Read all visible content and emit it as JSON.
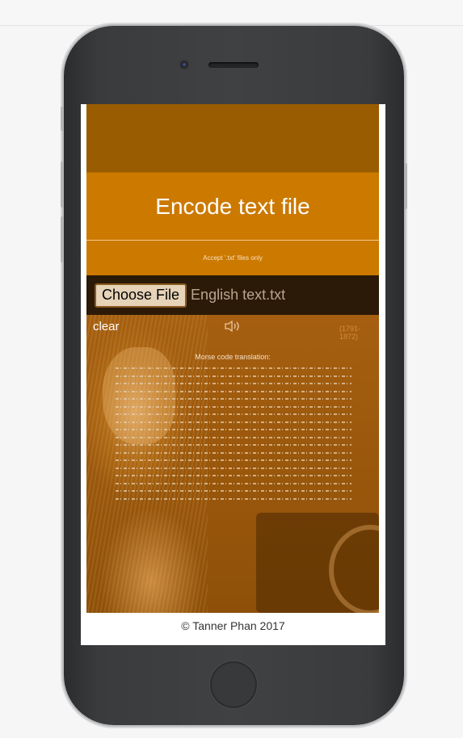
{
  "app": {
    "title": "Encode text file",
    "subtitle": "Accept '.txt' files only",
    "choose_file_label": "Choose File",
    "file_name": "English text.txt",
    "clear_label": "clear",
    "speaker_icon": "speaker-icon",
    "years": "(1791-1872)",
    "morse_label": "Morse code translation:",
    "footer": "© Tanner Phan 2017"
  },
  "colors": {
    "header_dark": "#9a5c00",
    "accent": "#cc7900",
    "file_bar": "#2c1a09"
  }
}
